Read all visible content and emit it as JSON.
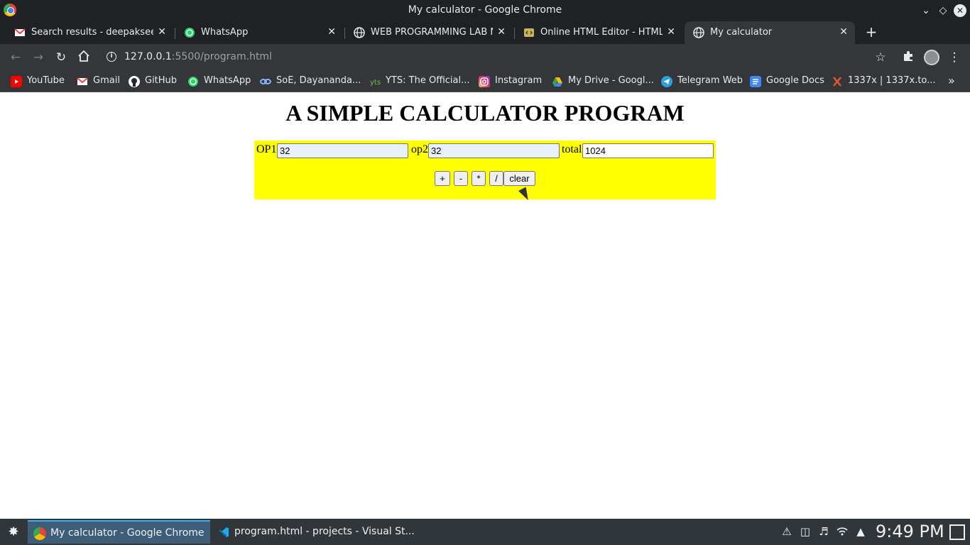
{
  "window": {
    "title": "My calculator - Google Chrome"
  },
  "tabs": [
    {
      "label": "Search results - deepakseervi",
      "icon": "gmail-icon"
    },
    {
      "label": "WhatsApp",
      "icon": "whatsapp-icon"
    },
    {
      "label": "WEB PROGRAMMING LAB MA",
      "icon": "globe-icon"
    },
    {
      "label": "Online HTML Editor - HTML-",
      "icon": "html-editor-icon"
    },
    {
      "label": "My calculator",
      "icon": "globe-icon",
      "active": true
    }
  ],
  "omnibox": {
    "url_host": "127.0.0.1",
    "url_path": ":5500/program.html"
  },
  "bookmarks": [
    {
      "label": "YouTube",
      "icon": "youtube-icon",
      "color": "#ff0000"
    },
    {
      "label": "Gmail",
      "icon": "gmail-icon",
      "color": "#ea4335"
    },
    {
      "label": "GitHub",
      "icon": "github-icon",
      "color": "#ffffff"
    },
    {
      "label": "WhatsApp",
      "icon": "whatsapp-icon",
      "color": "#25d366"
    },
    {
      "label": "SoE, Dayananda...",
      "icon": "link-icon",
      "color": "#8ab4f8"
    },
    {
      "label": "YTS: The Official...",
      "icon": "yts-icon",
      "color": "#6ac045"
    },
    {
      "label": "Instagram",
      "icon": "instagram-icon",
      "color": "#e1306c"
    },
    {
      "label": "My Drive - Googl...",
      "icon": "drive-icon",
      "color": "#fbbc05"
    },
    {
      "label": "Telegram Web",
      "icon": "telegram-icon",
      "color": "#2aa1da"
    },
    {
      "label": "Google Docs",
      "icon": "docs-icon",
      "color": "#4285f4"
    },
    {
      "label": "1337x | 1337x.to...",
      "icon": "x-icon",
      "color": "#e4572e"
    }
  ],
  "page": {
    "heading": "A SIMPLE CALCULATOR PROGRAM",
    "op1_label": "OP1",
    "op1_value": "32",
    "op2_label": "op2",
    "op2_value": "32",
    "total_label": "total",
    "total_value": "1024",
    "buttons": {
      "add": "+",
      "subtract": "-",
      "multiply": "*",
      "divide": "/",
      "clear": "clear"
    },
    "background_color": "#ffff00"
  },
  "taskbar": {
    "tasks": [
      {
        "label": "My calculator - Google Chrome",
        "active": true
      },
      {
        "label": "program.html - projects - Visual St..."
      }
    ],
    "clock": "9:49 PM"
  }
}
